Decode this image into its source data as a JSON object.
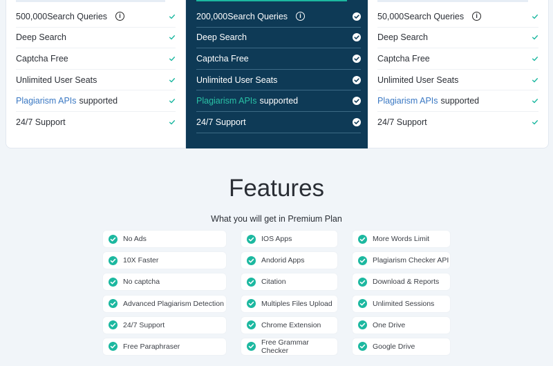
{
  "plans": [
    {
      "id": "left",
      "rows": [
        {
          "bold": "500,000",
          "text": "Search Queries",
          "info": true
        },
        {
          "text": "Deep Search"
        },
        {
          "text": "Captcha Free"
        },
        {
          "text": "Unlimited User Seats"
        },
        {
          "link": "Plagiarism APIs",
          "text": "supported"
        },
        {
          "text": "24/7 Support"
        }
      ]
    },
    {
      "id": "center",
      "rows": [
        {
          "bold": "200,000",
          "text": "Search Queries",
          "info": true
        },
        {
          "text": "Deep Search"
        },
        {
          "text": "Captcha Free"
        },
        {
          "text": "Unlimited User Seats"
        },
        {
          "link": "Plagiarism APIs",
          "text": "supported"
        },
        {
          "text": "24/7 Support"
        }
      ]
    },
    {
      "id": "right",
      "rows": [
        {
          "bold": "50,000",
          "text": "Search Queries",
          "info": true
        },
        {
          "text": "Deep Search"
        },
        {
          "text": "Captcha Free"
        },
        {
          "text": "Unlimited User Seats"
        },
        {
          "link": "Plagiarism APIs",
          "text": "supported"
        },
        {
          "text": "24/7 Support"
        }
      ]
    }
  ],
  "info_glyph": "i",
  "features": {
    "title": "Features",
    "subtitle": "What you will get in Premium Plan",
    "columns": [
      [
        "No Ads",
        "10X Faster",
        "No captcha",
        "Advanced Plagiarism Detection",
        "24/7 Support",
        "Free Paraphraser"
      ],
      [
        "IOS Apps",
        "Andorid Apps",
        "Citation",
        "Multiples Files Upload",
        "Chrome Extension",
        "Free Grammar Checker"
      ],
      [
        "More Words Limit",
        "Plagiarism Checker API",
        "Download & Reports",
        "Unlimited Sessions",
        "One Drive",
        "Google Drive"
      ]
    ]
  },
  "colors": {
    "accent": "#1cb8a0",
    "featured_bg": "#0e3a56",
    "link": "#3a78c3",
    "page_bg": "#f1f5f9"
  },
  "icons": {
    "info": "info-icon",
    "tick": "tick-icon",
    "circle_tick": "circle-check-icon"
  }
}
